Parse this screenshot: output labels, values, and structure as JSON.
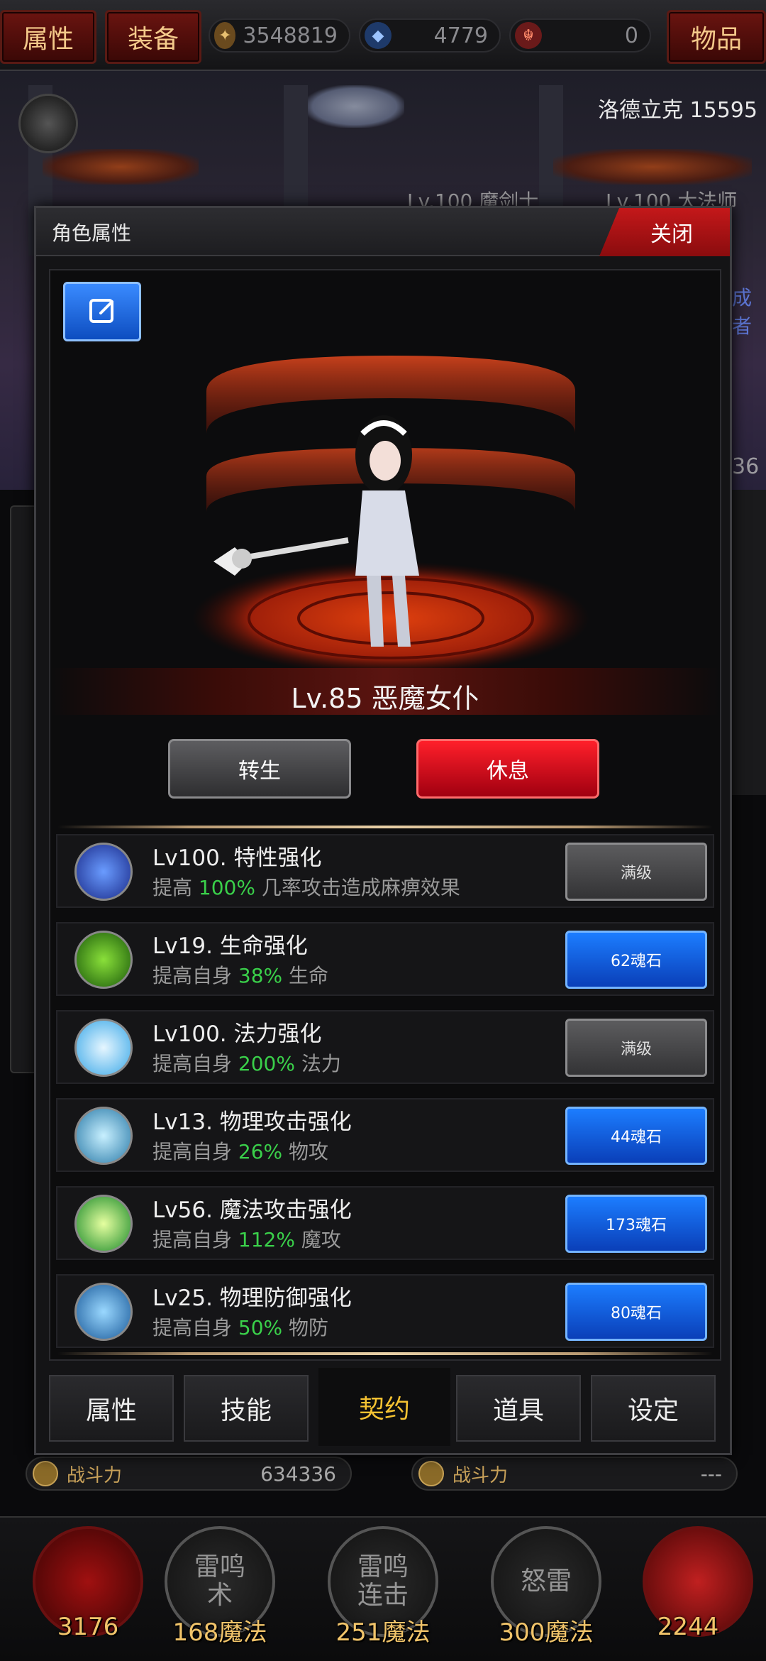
{
  "topbar": {
    "attr_btn": "属性",
    "equip_btn": "装备",
    "items_btn": "物品",
    "currencies": [
      {
        "icon": "gold-coin-icon",
        "value": "3548819"
      },
      {
        "icon": "blue-gem-icon",
        "value": "4779"
      },
      {
        "icon": "red-soul-icon",
        "value": "0"
      }
    ]
  },
  "scene": {
    "player_name": "洛德立克 15595",
    "lv_left": "Lv.100 魔剑士",
    "lv_right": "Lv.100 大法师",
    "side_text": "成者",
    "side_num": "36"
  },
  "modal": {
    "title": "角色属性",
    "close": "关闭",
    "character_name": "Lv.85 恶魔女仆",
    "rebirth_btn": "转生",
    "rest_btn": "休息",
    "upgrades": [
      {
        "icon": "paralysis-orb-icon",
        "title": "Lv100. 特性强化",
        "prefix": "提高 ",
        "pct": "100%",
        "suffix": " 几率攻击造成麻痹效果",
        "btn": "满级",
        "btn_type": "max",
        "color": "#2a4cc8"
      },
      {
        "icon": "life-orb-icon",
        "title": "Lv19. 生命强化",
        "prefix": "提高自身 ",
        "pct": "38%",
        "suffix": " 生命",
        "btn": "62魂石",
        "btn_type": "blue",
        "color": "#3aa41a"
      },
      {
        "icon": "mana-orb-icon",
        "title": "Lv100. 法力强化",
        "prefix": "提高自身 ",
        "pct": "200%",
        "suffix": " 法力",
        "btn": "满级",
        "btn_type": "max",
        "color": "#5ac8ff"
      },
      {
        "icon": "physical-attack-orb-icon",
        "title": "Lv13. 物理攻击强化",
        "prefix": "提高自身 ",
        "pct": "26%",
        "suffix": " 物攻",
        "btn": "44魂石",
        "btn_type": "blue",
        "color": "#58a8c8"
      },
      {
        "icon": "magic-attack-orb-icon",
        "title": "Lv56. 魔法攻击强化",
        "prefix": "提高自身 ",
        "pct": "112%",
        "suffix": " 魔攻",
        "btn": "173魂石",
        "btn_type": "blue",
        "color": "#2aa838"
      },
      {
        "icon": "physical-defense-orb-icon",
        "title": "Lv25. 物理防御强化",
        "prefix": "提高自身 ",
        "pct": "50%",
        "suffix": " 物防",
        "btn": "80魂石",
        "btn_type": "blue",
        "color": "#2a88c8"
      }
    ],
    "tabs": [
      "属性",
      "技能",
      "契约",
      "道具",
      "设定"
    ],
    "active_tab": "契约"
  },
  "hud": {
    "power_label": "战斗力",
    "power_left": "634336",
    "power_right": "---",
    "skills": [
      {
        "name": "",
        "cost": "3176"
      },
      {
        "name": "雷鸣\n术",
        "cost": "168魔法"
      },
      {
        "name": "雷鸣\n连击",
        "cost": "251魔法"
      },
      {
        "name": "怒雷",
        "cost": "300魔法"
      },
      {
        "name": "",
        "cost": "2244"
      }
    ]
  },
  "colors": {
    "accent_red": "#c4181a",
    "accent_blue": "#1c7dff",
    "highlight_green": "#3ad04a",
    "tab_active": "#f5c232"
  }
}
